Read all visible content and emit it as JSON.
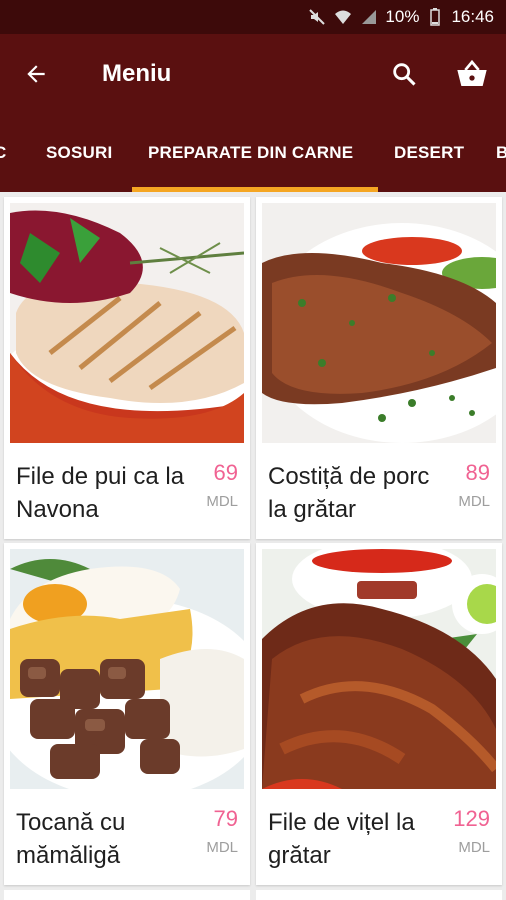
{
  "statusbar": {
    "battery": "10%",
    "time": "16:46"
  },
  "appbar": {
    "title": "Meniu"
  },
  "tabs": [
    {
      "label": "C"
    },
    {
      "label": "SOSURI"
    },
    {
      "label": "PREPARATE DIN CARNE"
    },
    {
      "label": "DESERT"
    },
    {
      "label": "B"
    }
  ],
  "active_tab_index": 2,
  "products": [
    {
      "name": "File de pui ca la Navona",
      "price": "69",
      "currency": "MDL"
    },
    {
      "name": "Costiță de porc la grătar",
      "price": "89",
      "currency": "MDL"
    },
    {
      "name": "Tocană cu mămăligă",
      "price": "79",
      "currency": "MDL"
    },
    {
      "name": "File de vițel la grătar",
      "price": "129",
      "currency": "MDL"
    }
  ],
  "colors": {
    "appbar": "#5a1010",
    "statusbar": "#3d0a0a",
    "accent": "#f5a623",
    "price": "#f06292"
  },
  "icons": [
    "mute-icon",
    "wifi-icon",
    "signal-icon",
    "battery-icon",
    "back-arrow-icon",
    "search-icon",
    "shopping-basket-icon"
  ]
}
